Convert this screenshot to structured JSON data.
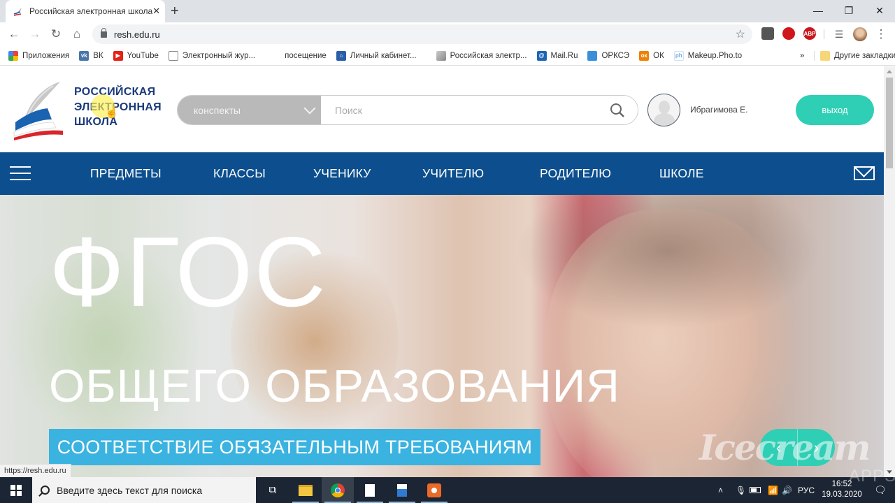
{
  "browser": {
    "tab_title": "Российская электронная школа",
    "url": "resh.edu.ru",
    "status_url": "https://resh.edu.ru",
    "bookmarks": [
      {
        "label": "Приложения",
        "icon": "apps-grid-icon",
        "color": "#4285f4"
      },
      {
        "label": "ВК",
        "icon": "vk-icon",
        "color": "#4a76a8"
      },
      {
        "label": "YouTube",
        "icon": "youtube-icon",
        "color": "#e62117"
      },
      {
        "label": "Электронный жур...",
        "icon": "document-icon",
        "color": "#888888"
      },
      {
        "label": "посещение",
        "icon": "",
        "color": ""
      },
      {
        "label": "Личный кабинет...",
        "icon": "bank-icon",
        "color": "#2b5ea8"
      },
      {
        "label": "Российская электр...",
        "icon": "resh-icon",
        "color": "#999999"
      },
      {
        "label": "Mail.Ru",
        "icon": "mailru-icon",
        "color": "#1e65b4"
      },
      {
        "label": "ОРКСЭ",
        "icon": "orkse-icon",
        "color": "#3a8fd8"
      },
      {
        "label": "ОК",
        "icon": "odnoklassniki-icon",
        "color": "#ee8208"
      },
      {
        "label": "Makeup.Pho.to",
        "icon": "phototo-icon",
        "color": "#6aa9e0"
      }
    ],
    "more_bookmarks": "»",
    "other_bookmarks": "Другие закладки",
    "extensions": [
      {
        "name": "sound-extension-icon",
        "label": "",
        "color": "#555555"
      },
      {
        "name": "opera-adblock-icon",
        "label": "",
        "color": "#d0161b"
      },
      {
        "name": "adblock-plus-icon",
        "label": "ABP",
        "color": "#c8161d"
      }
    ]
  },
  "site": {
    "logo_lines": [
      "РОССИЙСКАЯ",
      "ЭЛЕКТРОННАЯ",
      "ШКОЛА"
    ],
    "search_category": "конспекты",
    "search_placeholder": "Поиск",
    "search_value": "",
    "username": "Ибрагимова Е.",
    "logout_label": "выход",
    "nav": [
      "ПРЕДМЕТЫ",
      "КЛАССЫ",
      "УЧЕНИКУ",
      "УЧИТЕЛЮ",
      "РОДИТЕЛЮ",
      "ШКОЛЕ"
    ],
    "hero": {
      "title": "ФГОС",
      "subtitle": "ОБЩЕГО ОБРАЗОВАНИЯ",
      "band": "СООТВЕТСТВИЕ ОБЯЗАТЕЛЬНЫМ ТРЕБОВАНИЯМ",
      "prev": "‹",
      "next": "›"
    },
    "colors": {
      "brand_blue": "#0d4f8e",
      "accent_teal": "#2fcfb5",
      "band_blue": "#3bb3e0"
    }
  },
  "watermark": "Icecream",
  "watermark_sub": "APPS",
  "taskbar": {
    "search_placeholder": "Введите здесь текст для поиска",
    "language": "РУС",
    "time": "16:52",
    "date": "19.03.2020"
  }
}
